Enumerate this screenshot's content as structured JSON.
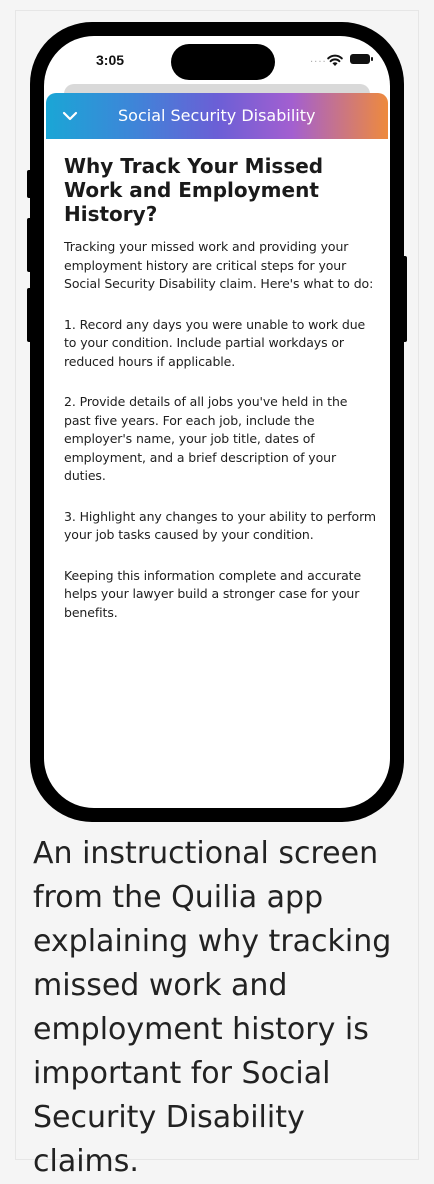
{
  "status_bar": {
    "time": "3:05",
    "signal": "....",
    "icons": [
      "wifi-icon",
      "battery-icon"
    ]
  },
  "header": {
    "icon": "chevron-down-icon",
    "title": "Social Security Disability",
    "gradient_colors": [
      "#1aa6d6",
      "#6b5fd6",
      "#a35fd0",
      "#ee8a3d"
    ]
  },
  "content": {
    "heading": "Why Track Your Missed Work and Employment History?",
    "paragraphs": [
      "Tracking your missed work and providing your employment history are critical steps for your Social Security Disability claim. Here's what to do:",
      "1. Record any days you were unable to work due to your condition. Include partial workdays or reduced hours if applicable.",
      "2. Provide details of all jobs you've held in the past five years. For each job, include the employer's name, your job title, dates of employment, and a brief description of your duties.",
      "3. Highlight any changes to your ability to perform your job tasks caused by your condition.",
      "Keeping this information complete and accurate helps your lawyer build a stronger case for your benefits."
    ]
  },
  "caption": "An instructional screen from the Quilia app explaining why tracking missed work and employment history is important for Social Security Disability claims."
}
